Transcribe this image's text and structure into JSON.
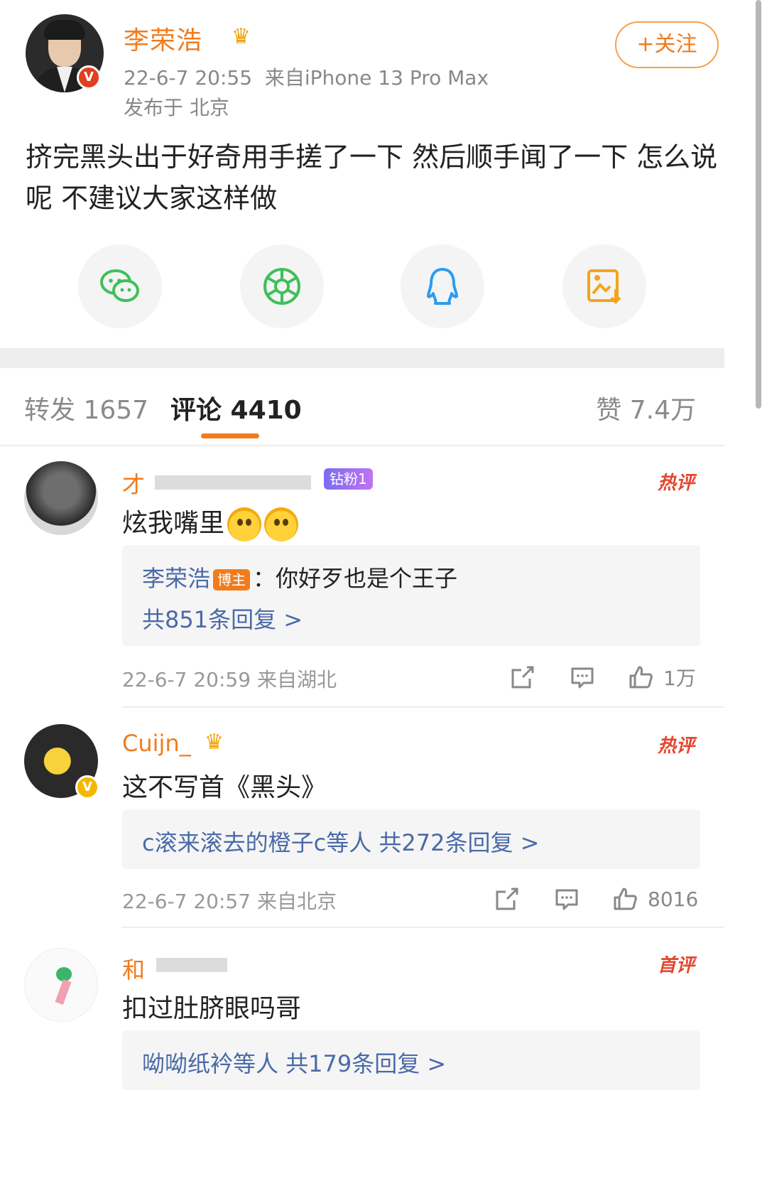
{
  "post": {
    "author": "李荣浩",
    "timestamp": "22-6-7 20:55",
    "source": "来自iPhone 13 Pro Max",
    "location": "发布于 北京",
    "follow_label": "+关注",
    "text": "挤完黑头出于好奇用手搓了一下 然后顺手闻了一下 怎么说呢  不建议大家这样做"
  },
  "share": [
    "wechat-icon",
    "moments-icon",
    "qq-icon",
    "save-image-icon"
  ],
  "tabs": {
    "repost": "转发 1657",
    "comments": "评论 4410",
    "likes": "赞 7.4万"
  },
  "colors": {
    "accent": "#f07c1e",
    "link": "#4a6aa8",
    "hot": "#e4462f"
  },
  "comments": [
    {
      "name_visible": "才",
      "badge": "钻粉1",
      "tag": "热评",
      "text": "炫我嘴里",
      "reply_author": "李荣浩",
      "reply_owner_tag": "博主",
      "reply_text": "：你好歹也是个王子",
      "reply_count": "共851条回复 >",
      "time": "22-6-7 20:59 来自湖北",
      "likes": "1万"
    },
    {
      "name_visible": "Cuijn_",
      "tag": "热评",
      "text": "这不写首《黑头》",
      "reply_summary": "c滚来滚去的橙子c等人  共272条回复 >",
      "time": "22-6-7 20:57 来自北京",
      "likes": "8016"
    },
    {
      "name_visible": "和",
      "tag": "首评",
      "text": "扣过肚脐眼吗哥",
      "reply_summary": "呦呦纸衿等人  共179条回复 >"
    }
  ]
}
